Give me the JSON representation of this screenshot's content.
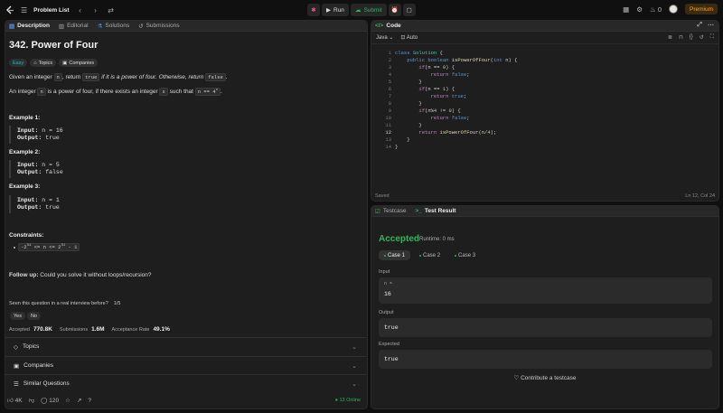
{
  "topbar": {
    "title": "Problem List",
    "run_label": "Run",
    "submit_label": "Submit",
    "streak_count": "0",
    "premium_label": "Premium"
  },
  "left_tabs": [
    {
      "label": "Description"
    },
    {
      "label": "Editorial"
    },
    {
      "label": "Solutions"
    },
    {
      "label": "Submissions"
    }
  ],
  "problem": {
    "title": "342. Power of Four",
    "difficulty": "Easy",
    "topics_chip": "Topics",
    "companies_chip": "Companies",
    "line1_a": "Given an integer ",
    "line1_n": "n",
    "line1_b": ", return ",
    "line1_true": "true",
    "line1_c": " if it is a power of four. Otherwise, return ",
    "line1_false": "false",
    "line1_d": ".",
    "line2_a": "An integer ",
    "line2_n": "n",
    "line2_b": " is a power of four, if there exists an integer ",
    "line2_x": "x",
    "line2_c": " such that ",
    "line2_expr": "n == 4",
    "line2_sup": "x",
    "line2_d": "."
  },
  "examples": [
    {
      "heading": "Example 1:",
      "input_label": "Input:",
      "input": " n = 16",
      "output_label": "Output:",
      "output": " true"
    },
    {
      "heading": "Example 2:",
      "input_label": "Input:",
      "input": " n = 5",
      "output_label": "Output:",
      "output": " false"
    },
    {
      "heading": "Example 3:",
      "input_label": "Input:",
      "input": " n = 1",
      "output_label": "Output:",
      "output": " true"
    }
  ],
  "constraints": {
    "heading": "Constraints:",
    "item_a": "-2",
    "item_sup1": "31",
    "item_b": " <= n <= 2",
    "item_sup2": "31",
    "item_c": " - 1"
  },
  "followup": {
    "label": "Follow up:",
    "text": " Could you solve it without loops/recursion?"
  },
  "survey": {
    "question": "Seen this question in a real interview before?",
    "progress": "1/5",
    "yes": "Yes",
    "no": "No"
  },
  "stats": {
    "accepted_label": "Accepted",
    "accepted_value": "770.8K",
    "submissions_label": "Submissions",
    "submissions_value": "1.6M",
    "rate_label": "Acceptance Rate",
    "rate_value": "49.1%"
  },
  "accordions": [
    {
      "label": "Topics"
    },
    {
      "label": "Companies"
    },
    {
      "label": "Similar Questions"
    }
  ],
  "bottom": {
    "likes": "4K",
    "comments": "120",
    "online": "13 Online"
  },
  "code_panel": {
    "title": "Code",
    "language": "Java",
    "mode": "Auto",
    "status_left": "Saved",
    "status_right": "Ln 12, Col 24"
  },
  "code_lines": [
    {
      "n": "1",
      "t": "class Solution {"
    },
    {
      "n": "2",
      "t": "    public boolean isPowerOfFour(int n) {"
    },
    {
      "n": "3",
      "t": "        if(n == 0) {"
    },
    {
      "n": "4",
      "t": "            return false;"
    },
    {
      "n": "5",
      "t": "        }"
    },
    {
      "n": "6",
      "t": "        if(n == 1) {"
    },
    {
      "n": "7",
      "t": "            return true;"
    },
    {
      "n": "8",
      "t": "        }"
    },
    {
      "n": "9",
      "t": "        if(n%4 != 0) {"
    },
    {
      "n": "10",
      "t": "            return false;"
    },
    {
      "n": "11",
      "t": "        }"
    },
    {
      "n": "12",
      "t": "        return isPowerOfFour(n/4);"
    },
    {
      "n": "13",
      "t": "    }"
    },
    {
      "n": "14",
      "t": "}"
    }
  ],
  "result_panel": {
    "tab_testcase": "Testcase",
    "tab_result": "Test Result",
    "status": "Accepted",
    "runtime": "Runtime: 0 ms",
    "cases": [
      "Case 1",
      "Case 2",
      "Case 3"
    ],
    "input_label": "Input",
    "input_var": "n =",
    "input_value": "16",
    "output_label": "Output",
    "output_value": "true",
    "expected_label": "Expected",
    "expected_value": "true",
    "contribute": "Contribute a testcase"
  }
}
